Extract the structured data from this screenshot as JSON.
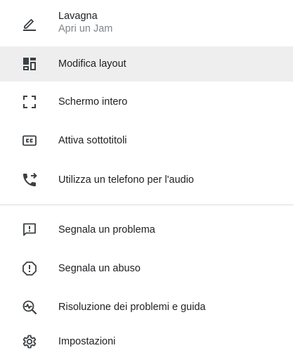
{
  "menu": {
    "items": [
      {
        "label": "Lavagna",
        "sublabel": "Apri un Jam",
        "icon": "pencil-underline-icon"
      },
      {
        "label": "Modifica layout",
        "icon": "layout-grid-icon",
        "state": "hovered"
      },
      {
        "label": "Schermo intero",
        "icon": "fullscreen-icon"
      },
      {
        "label": "Attiva sottotitoli",
        "icon": "closed-captions-icon"
      },
      {
        "label": "Utilizza un telefono per l'audio",
        "icon": "phone-forward-icon"
      },
      {
        "label": "Segnala un problema",
        "icon": "feedback-icon"
      },
      {
        "label": "Segnala un abuso",
        "icon": "report-icon"
      },
      {
        "label": "Risoluzione dei problemi e guida",
        "icon": "troubleshoot-icon"
      },
      {
        "label": "Impostazioni",
        "icon": "gear-icon"
      }
    ]
  },
  "colors": {
    "text": "#202124",
    "subtext": "#80868b",
    "icon": "#3c4043",
    "hover_bg": "#eeeeee",
    "divider": "#dadce0"
  }
}
